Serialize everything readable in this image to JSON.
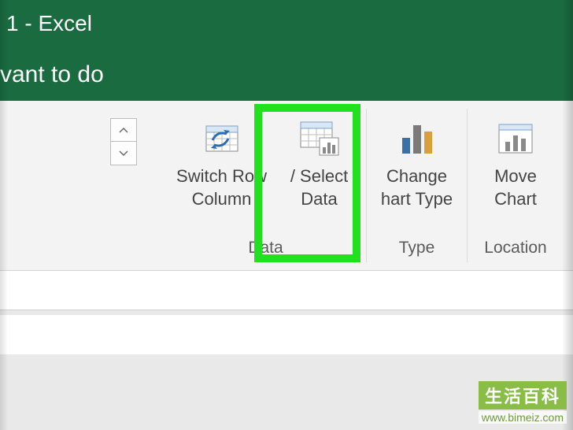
{
  "titlebar": "1  -  Excel",
  "tellme": "vant to do",
  "ribbon": {
    "switch": {
      "line1": "Switch Row",
      "line2": "Column"
    },
    "select": {
      "line1": "/ Select",
      "line2": "Data"
    },
    "change": {
      "line1": "Change",
      "line2": "hart Type"
    },
    "move": {
      "line1": "Move",
      "line2": "Chart"
    },
    "group_data": "Data",
    "group_type": "Type",
    "group_location": "Location"
  },
  "watermark": {
    "brand": "生活百科",
    "url": "www.bimeiz.com"
  }
}
